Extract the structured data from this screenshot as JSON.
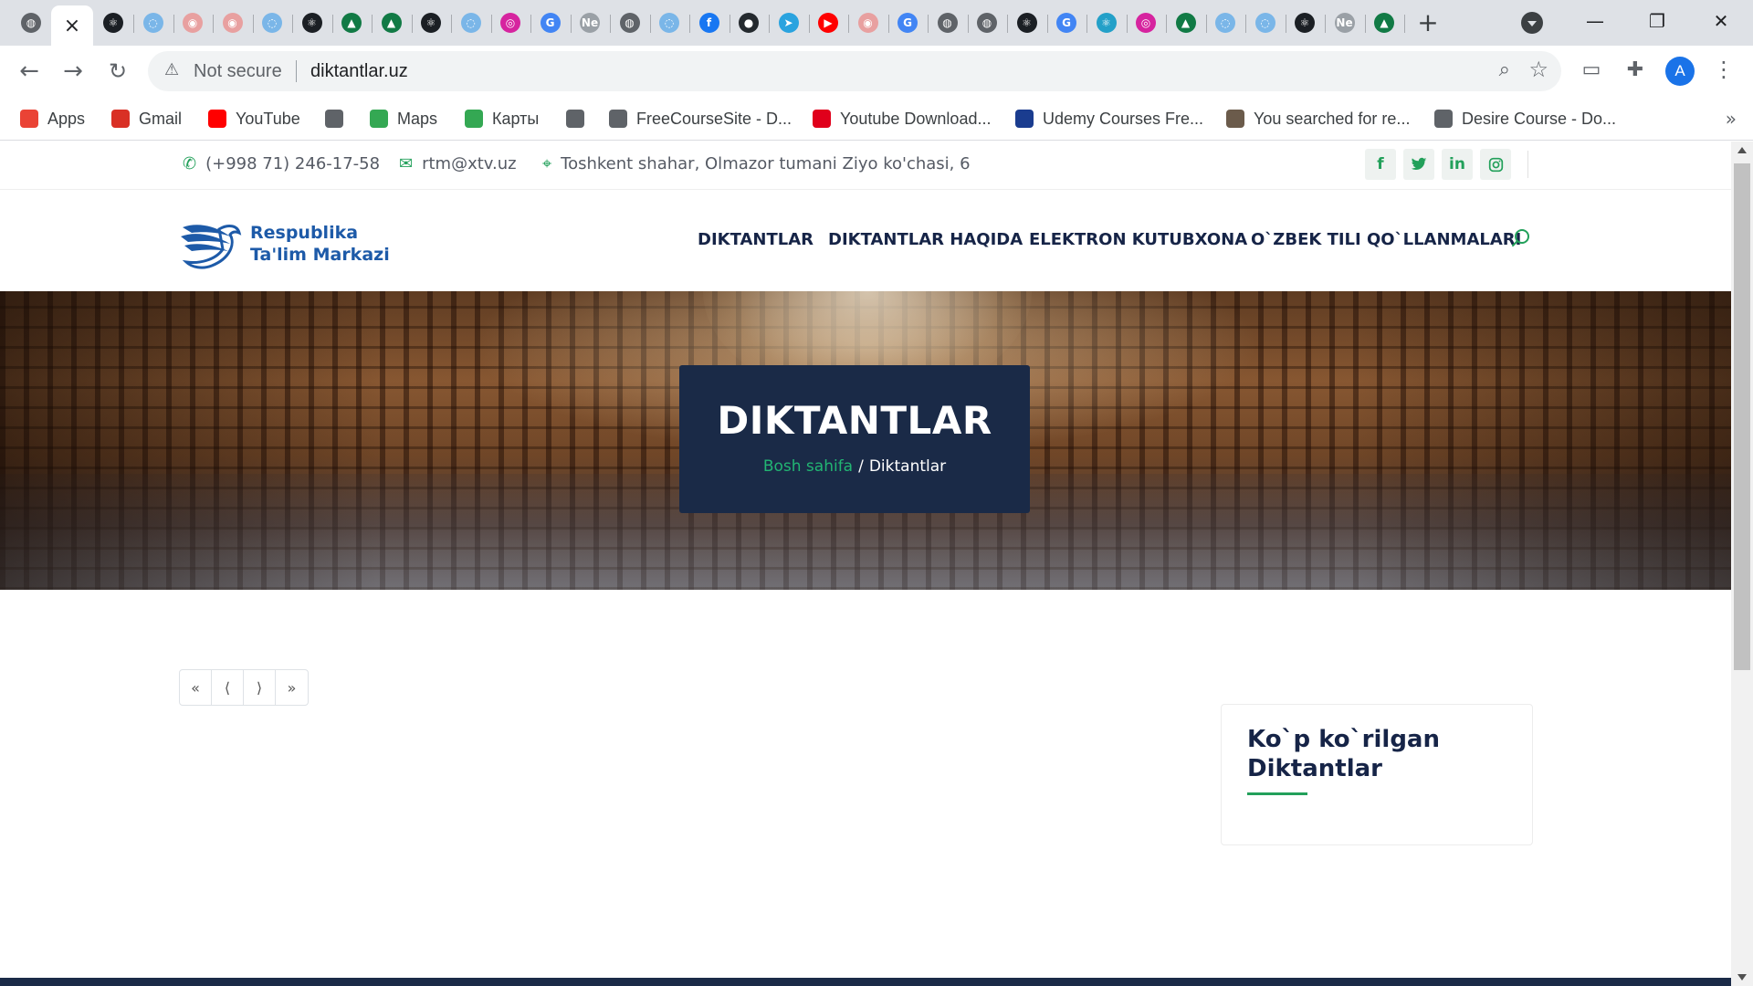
{
  "browser": {
    "active_tab_close": "×",
    "tab_favicons": [
      {
        "name": "globe-tab-icon",
        "glyph": "◍",
        "color": "#5f6368"
      },
      {
        "name": "react-tab-icon",
        "glyph": "⚛",
        "color": "#1b1f24"
      },
      {
        "name": "orbit-tab-icon",
        "glyph": "◌",
        "color": "#7ab6e8"
      },
      {
        "name": "pc-tab-icon",
        "glyph": "◉",
        "color": "#e8a0a0"
      },
      {
        "name": "pc-tab-icon",
        "glyph": "◉",
        "color": "#e8a0a0"
      },
      {
        "name": "orbit-tab-icon",
        "glyph": "◌",
        "color": "#7ab6e8"
      },
      {
        "name": "react-tab-icon",
        "glyph": "⚛",
        "color": "#1b1f24"
      },
      {
        "name": "graduation-tab-icon",
        "glyph": "▲",
        "color": "#117a45"
      },
      {
        "name": "graduation-tab-icon",
        "glyph": "▲",
        "color": "#117a45"
      },
      {
        "name": "react-tab-icon",
        "glyph": "⚛",
        "color": "#1b1f24"
      },
      {
        "name": "orbit-tab-icon",
        "glyph": "◌",
        "color": "#7ab6e8"
      },
      {
        "name": "instagram-tab-icon",
        "glyph": "◎",
        "color": "#d6249f"
      },
      {
        "name": "google-tab-icon",
        "glyph": "G",
        "color": "#4285f4"
      },
      {
        "name": "ne-tab-icon",
        "glyph": "Ne",
        "color": "#9aa0a6"
      },
      {
        "name": "globe-tab-icon",
        "glyph": "◍",
        "color": "#5f6368"
      },
      {
        "name": "orbit-tab-icon",
        "glyph": "◌",
        "color": "#7ab6e8"
      },
      {
        "name": "facebook-tab-icon",
        "glyph": "f",
        "color": "#1877f2"
      },
      {
        "name": "github-tab-icon",
        "glyph": "●",
        "color": "#24292e"
      },
      {
        "name": "telegram-tab-icon",
        "glyph": "➤",
        "color": "#2aa3df"
      },
      {
        "name": "youtube-tab-icon",
        "glyph": "▶",
        "color": "#ff0000"
      },
      {
        "name": "pc-tab-icon",
        "glyph": "◉",
        "color": "#e8a0a0"
      },
      {
        "name": "google-tab-icon",
        "glyph": "G",
        "color": "#4285f4"
      },
      {
        "name": "globe-tab-icon",
        "glyph": "◍",
        "color": "#5f6368"
      },
      {
        "name": "globe-tab-icon",
        "glyph": "◍",
        "color": "#5f6368"
      },
      {
        "name": "react-tab-icon",
        "glyph": "⚛",
        "color": "#1b1f24"
      },
      {
        "name": "google-tab-icon",
        "glyph": "G",
        "color": "#4285f4"
      },
      {
        "name": "react-tab-icon",
        "glyph": "⚛",
        "color": "#23a0c8"
      },
      {
        "name": "instagram-tab-icon",
        "glyph": "◎",
        "color": "#d6249f"
      },
      {
        "name": "graduation-tab-icon",
        "glyph": "▲",
        "color": "#117a45"
      },
      {
        "name": "orbit-tab-icon",
        "glyph": "◌",
        "color": "#7ab6e8"
      },
      {
        "name": "orbit-tab-icon",
        "glyph": "◌",
        "color": "#7ab6e8"
      },
      {
        "name": "react-tab-icon",
        "glyph": "⚛",
        "color": "#1b1f24"
      },
      {
        "name": "ne-tab-icon",
        "glyph": "Ne",
        "color": "#9aa0a6"
      },
      {
        "name": "graduation-tab-icon",
        "glyph": "▲",
        "color": "#117a45"
      }
    ],
    "new_tab": "+",
    "window_controls": {
      "minimize": "—",
      "restore": "❐",
      "close": "✕"
    },
    "security_label": "Not secure",
    "url": "diktantlar.uz",
    "profile_initial": "A",
    "bookmarks": [
      {
        "label": "Apps",
        "icon": "apps-grid-icon",
        "color": "#ea4335"
      },
      {
        "label": "Gmail",
        "icon": "gmail-icon",
        "color": "#d93025"
      },
      {
        "label": "YouTube",
        "icon": "youtube-icon",
        "color": "#ff0000"
      },
      {
        "label": "",
        "icon": "globe-icon",
        "color": "#5f6368"
      },
      {
        "label": "Maps",
        "icon": "maps-pin-icon",
        "color": "#34a853"
      },
      {
        "label": "Карты",
        "icon": "maps-pin-icon",
        "color": "#34a853"
      },
      {
        "label": "",
        "icon": "globe-icon",
        "color": "#5f6368"
      },
      {
        "label": "FreeCourseSite - D...",
        "icon": "globe-icon",
        "color": "#5f6368"
      },
      {
        "label": "Youtube Download...",
        "icon": "download-icon",
        "color": "#e0001b"
      },
      {
        "label": "Udemy Courses Fre...",
        "icon": "freedownload-icon",
        "color": "#1a3c8f"
      },
      {
        "label": "You searched for re...",
        "icon": "gear-logo-icon",
        "color": "#6b5b4b"
      },
      {
        "label": "Desire Course - Do...",
        "icon": "globe-icon",
        "color": "#5f6368"
      }
    ]
  },
  "site": {
    "contact": {
      "phone": "(+998 71) 246-17-58",
      "email": "rtm@xtv.uz",
      "address": "Toshkent shahar, Olmazor tumani Ziyo ko'chasi, 6"
    },
    "social": [
      "f",
      "t",
      "in",
      "ig"
    ],
    "logo": {
      "line1": "Respublika",
      "line2": "Ta'lim Markazi"
    },
    "nav": [
      "DIKTANTLAR",
      "DIKTANTLAR HAQIDA",
      "ELEKTRON KUTUBXONA",
      "O`ZBEK TILI QO`LLANMALARI"
    ],
    "hero": {
      "title": "DIKTANTLAR",
      "breadcrumb_home": "Bosh sahifa",
      "breadcrumb_sep": "/",
      "breadcrumb_current": "Diktantlar"
    },
    "pagination": [
      "«",
      "⟨",
      "⟩",
      "»"
    ],
    "sidebar": {
      "title": "Ko`p ko`rilgan Diktantlar"
    }
  },
  "colors": {
    "accent_green": "#22a05a",
    "navy": "#1a2a47",
    "logo_blue": "#1d5aa8"
  }
}
